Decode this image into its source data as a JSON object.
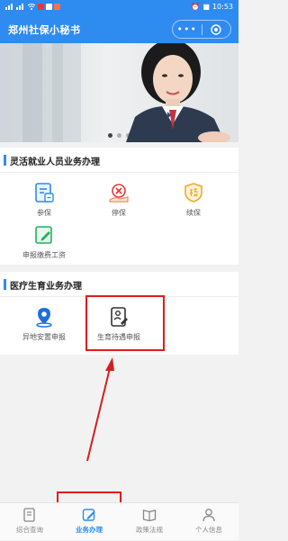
{
  "status_bar": {
    "time": "10:53",
    "battery": "■"
  },
  "header": {
    "title": "郑州社保小秘书",
    "more_glyph": "•••"
  },
  "banner": {
    "slides": 3,
    "active_slide": 1
  },
  "sections": [
    {
      "title": "灵活就业人员业务办理",
      "items": [
        {
          "label": "参保",
          "icon": "insure-doc-icon"
        },
        {
          "label": "停保",
          "icon": "stop-hand-icon"
        },
        {
          "label": "续保",
          "icon": "renew-shield-icon"
        },
        {
          "label": "申报缴费工资",
          "icon": "declare-pen-icon"
        }
      ]
    },
    {
      "title": "医疗生育业务办理",
      "items": [
        {
          "label": "异地安置申报",
          "icon": "relocation-pin-icon"
        },
        {
          "label": "生育待遇申报",
          "icon": "maternity-doc-icon"
        }
      ]
    }
  ],
  "tabs": [
    {
      "label": "综合查询",
      "icon": "query-doc-icon",
      "active": false
    },
    {
      "label": "业务办理",
      "icon": "edit-square-icon",
      "active": true
    },
    {
      "label": "政策法规",
      "icon": "policy-book-icon",
      "active": false
    },
    {
      "label": "个人信息",
      "icon": "person-icon",
      "active": false
    }
  ],
  "colors": {
    "primary": "#2e8bf0",
    "highlight": "#e21b1b",
    "active_tab": "#2e8bf0"
  }
}
